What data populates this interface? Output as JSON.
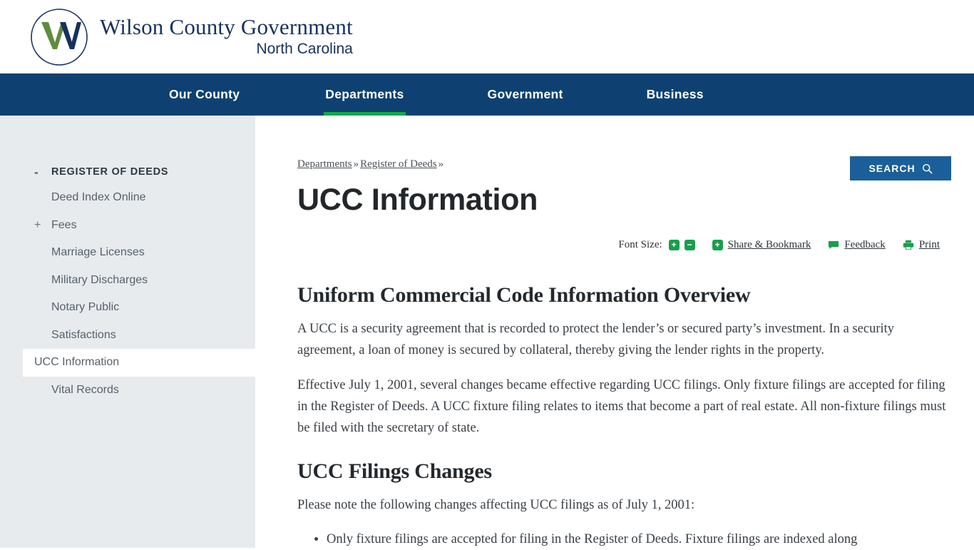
{
  "header": {
    "logo_icon": "wilson-county-w-logo",
    "title": "Wilson County Government",
    "subtitle": "North Carolina",
    "colors": {
      "navy": "#16325c",
      "green": "#5f8c3e"
    }
  },
  "nav": {
    "items": [
      {
        "label": "Our County",
        "active": false
      },
      {
        "label": "Departments",
        "active": true
      },
      {
        "label": "Government",
        "active": false
      },
      {
        "label": "Business",
        "active": false
      }
    ],
    "search_label": "SEARCH",
    "search_icon": "magnifier-icon",
    "bar_color": "#0e4172",
    "active_underline_color": "#14a84b",
    "search_button_color": "#1b5f9a"
  },
  "sidebar": {
    "section": {
      "toggle": "-",
      "label": "REGISTER OF DEEDS"
    },
    "items": [
      {
        "toggle": "",
        "label": "Deed Index Online",
        "current": false
      },
      {
        "toggle": "+",
        "label": "Fees",
        "current": false
      },
      {
        "toggle": "",
        "label": "Marriage Licenses",
        "current": false
      },
      {
        "toggle": "",
        "label": "Military Discharges",
        "current": false
      },
      {
        "toggle": "",
        "label": "Notary Public",
        "current": false
      },
      {
        "toggle": "",
        "label": "Satisfactions",
        "current": false
      },
      {
        "toggle": "",
        "label": "UCC Information",
        "current": true
      },
      {
        "toggle": "",
        "label": "Vital Records",
        "current": false
      }
    ]
  },
  "breadcrumb": {
    "items": [
      "Departments",
      "Register of Deeds"
    ],
    "separator": "»",
    "trailing_separator": "»"
  },
  "page": {
    "title": "UCC Information"
  },
  "toolbar": {
    "font_size_label": "Font Size:",
    "increase_icon": "plus-icon",
    "increase_glyph": "+",
    "decrease_icon": "minus-icon",
    "decrease_glyph": "−",
    "share_icon": "plus-icon",
    "share_glyph": "+",
    "share_label": "Share & Bookmark",
    "feedback_icon": "speech-bubble-icon",
    "feedback_label": "Feedback",
    "print_icon": "printer-icon",
    "print_label": "Print",
    "icon_color": "#17a04c"
  },
  "article": {
    "heading1": "Uniform Commercial Code Information Overview",
    "paragraph1": "A UCC is a security agreement that is recorded to protect the lender’s or secured party’s investment. In a security agreement, a loan of money is secured by collateral, thereby giving the lender rights in the property.",
    "paragraph2": "Effective July 1, 2001, several changes became effective regarding UCC filings. Only fixture filings are accepted for filing in the Register of Deeds. A UCC fixture filing relates to items that become a part of real estate. All non-fixture filings must be filed with the secretary of state.",
    "heading2": "UCC Filings Changes",
    "paragraph3": "Please note the following changes affecting UCC filings as of July 1, 2001:",
    "list": [
      "Only fixture filings are accepted for filing in the Register of Deeds. Fixture filings are indexed along"
    ]
  }
}
